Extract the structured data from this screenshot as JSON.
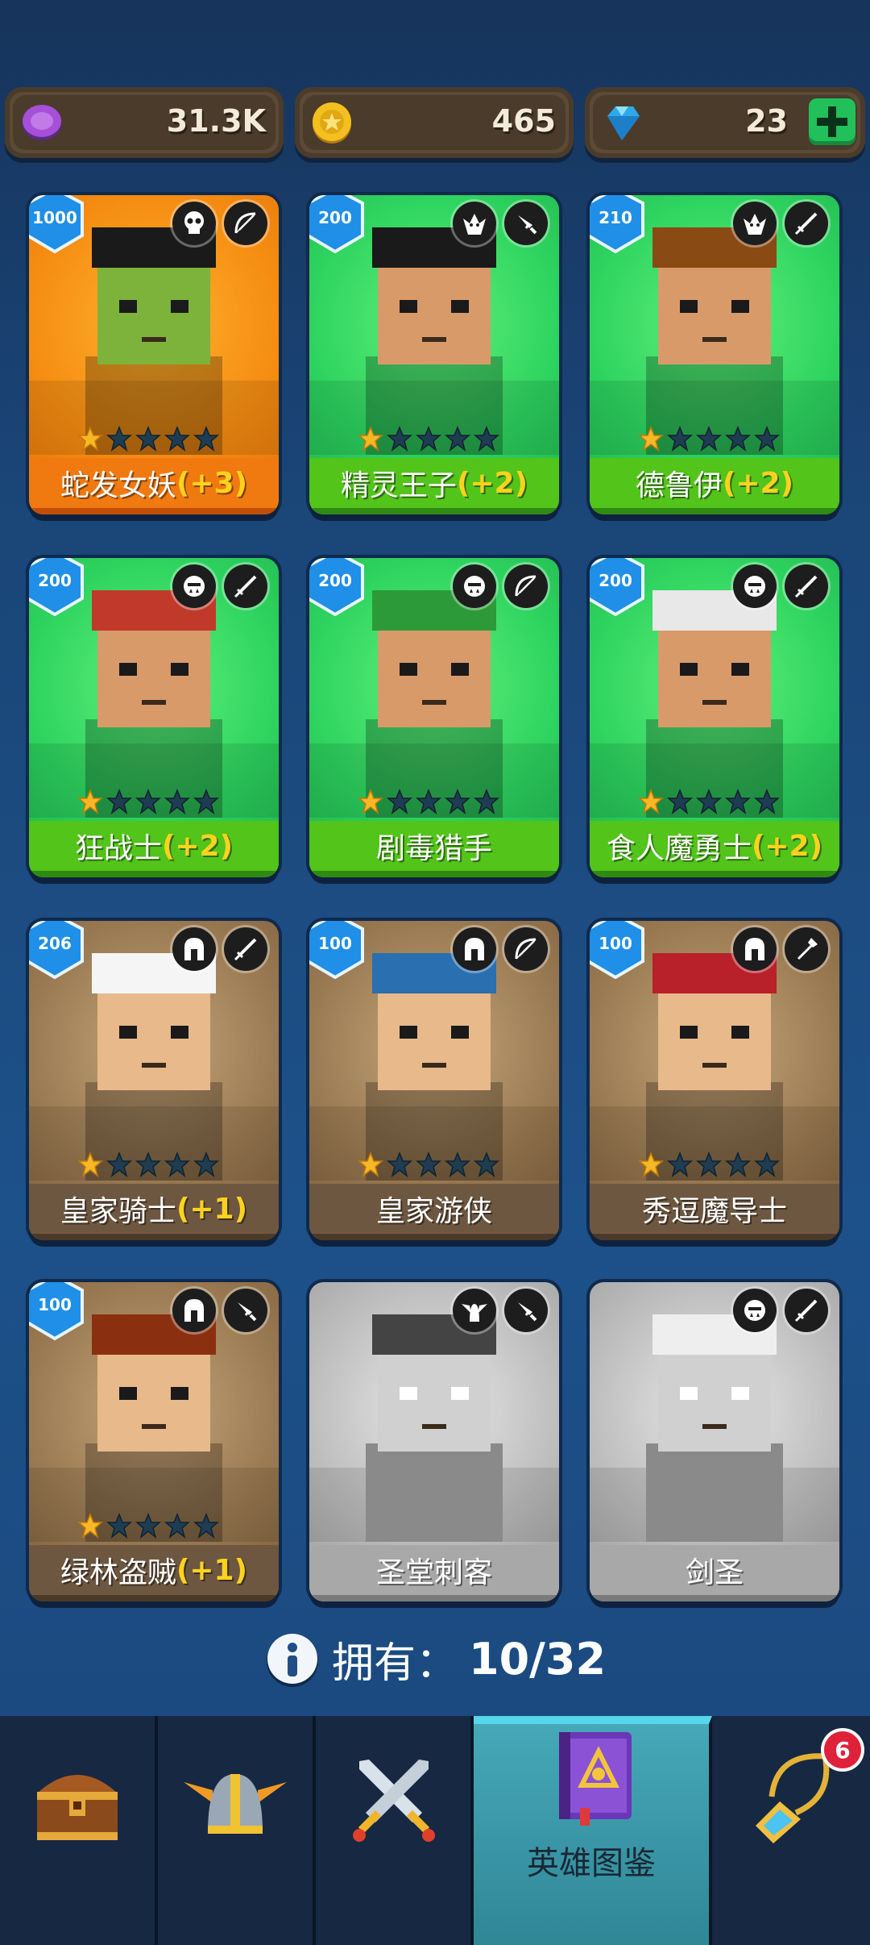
{
  "resources": [
    {
      "name": "elixir",
      "value": "31.3K",
      "icon": "purple-coin-icon"
    },
    {
      "name": "gold",
      "value": "465",
      "icon": "gold-coin-icon"
    },
    {
      "name": "gems",
      "value": "23",
      "icon": "diamond-icon"
    }
  ],
  "heroes": [
    {
      "name": "蛇发女妖",
      "bonus": "(+3)",
      "level": "1000",
      "theme": "orange",
      "stars": 1,
      "class_icon": "skull-icon",
      "weapon_icon": "bow-icon",
      "locked": false
    },
    {
      "name": "精灵王子",
      "bonus": "(+2)",
      "level": "200",
      "theme": "green",
      "stars": 1,
      "class_icon": "elf-icon",
      "weapon_icon": "dagger-icon",
      "locked": false
    },
    {
      "name": "德鲁伊",
      "bonus": "(+2)",
      "level": "210",
      "theme": "green",
      "stars": 1,
      "class_icon": "elf-icon",
      "weapon_icon": "sword-icon",
      "locked": false
    },
    {
      "name": "狂战士",
      "bonus": "(+2)",
      "level": "200",
      "theme": "green",
      "stars": 1,
      "class_icon": "orc-icon",
      "weapon_icon": "sword-icon",
      "locked": false
    },
    {
      "name": "剧毒猎手",
      "bonus": "",
      "level": "200",
      "theme": "green",
      "stars": 1,
      "class_icon": "orc-icon",
      "weapon_icon": "bow-icon",
      "locked": false
    },
    {
      "name": "食人魔勇士",
      "bonus": "(+2)",
      "level": "200",
      "theme": "green",
      "stars": 1,
      "class_icon": "orc-icon",
      "weapon_icon": "sword-icon",
      "locked": false
    },
    {
      "name": "皇家骑士",
      "bonus": "(+1)",
      "level": "206",
      "theme": "brown",
      "stars": 1,
      "class_icon": "helmet-icon",
      "weapon_icon": "sword-icon",
      "locked": false
    },
    {
      "name": "皇家游侠",
      "bonus": "",
      "level": "100",
      "theme": "brown",
      "stars": 1,
      "class_icon": "helmet-icon",
      "weapon_icon": "bow-icon",
      "locked": false
    },
    {
      "name": "秀逗魔导士",
      "bonus": "",
      "level": "100",
      "theme": "brown",
      "stars": 1,
      "class_icon": "helmet-icon",
      "weapon_icon": "staff-icon",
      "locked": false
    },
    {
      "name": "绿林盗贼",
      "bonus": "(+1)",
      "level": "100",
      "theme": "brown",
      "stars": 1,
      "class_icon": "helmet-icon",
      "weapon_icon": "dagger-icon",
      "locked": false
    },
    {
      "name": "圣堂刺客",
      "bonus": "",
      "level": "",
      "theme": "gray",
      "stars": 0,
      "class_icon": "winged-icon",
      "weapon_icon": "dagger-icon",
      "locked": true
    },
    {
      "name": "剑圣",
      "bonus": "",
      "level": "",
      "theme": "gray",
      "stars": 0,
      "class_icon": "orc-icon",
      "weapon_icon": "sword-icon",
      "locked": true
    }
  ],
  "owned": {
    "label": "拥有：",
    "value": "10/32"
  },
  "nav": {
    "tabs": [
      {
        "icon": "chest-icon",
        "label": ""
      },
      {
        "icon": "winged-helmet-icon",
        "label": ""
      },
      {
        "icon": "crossed-swords-icon",
        "label": ""
      },
      {
        "icon": "hero-book-icon",
        "label": "英雄图鉴"
      },
      {
        "icon": "amulet-icon",
        "label": ""
      }
    ],
    "notification": "6"
  }
}
